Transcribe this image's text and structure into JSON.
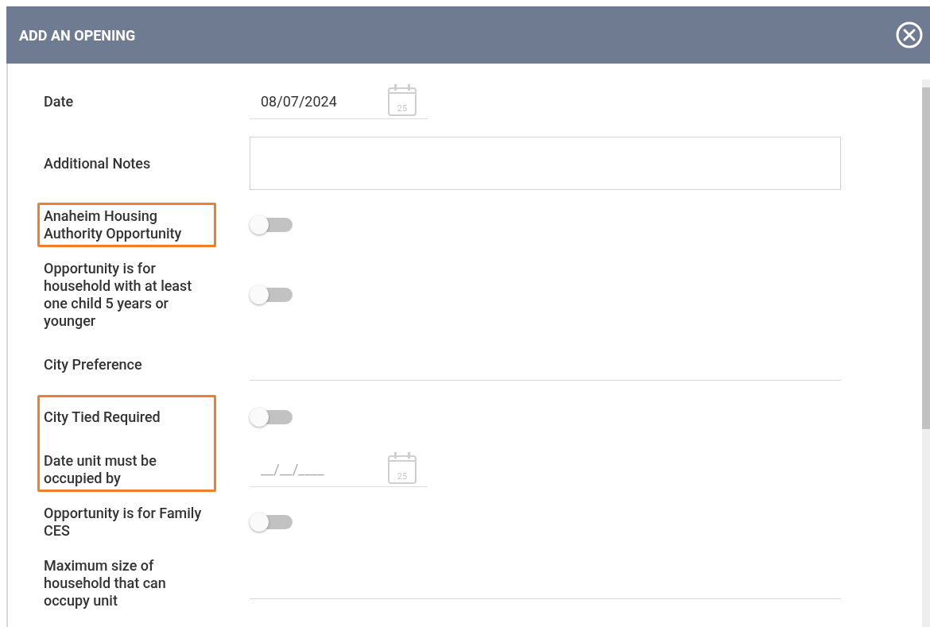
{
  "dialog": {
    "title": "ADD AN OPENING"
  },
  "groups": [
    {
      "highlighted": false,
      "fields": [
        {
          "kind": "date",
          "label": "Date",
          "value": "08/07/2024",
          "calendar_day": "25"
        },
        {
          "kind": "textarea",
          "label": "Additional Notes"
        }
      ]
    },
    {
      "highlighted": true,
      "fields": [
        {
          "kind": "toggle",
          "label": "Anaheim Housing Authority Opportunity",
          "on": false
        }
      ]
    },
    {
      "highlighted": false,
      "fields": [
        {
          "kind": "toggle",
          "label": "Opportunity is for household with at least one child 5 years or younger",
          "on": false
        },
        {
          "kind": "text",
          "label": "City Preference"
        }
      ]
    },
    {
      "highlighted": true,
      "fields": [
        {
          "kind": "toggle",
          "label": "City Tied Required",
          "on": false
        },
        {
          "kind": "date",
          "label": "Date unit must be occupied by",
          "placeholder": "__/__/____",
          "calendar_day": "25"
        }
      ]
    },
    {
      "highlighted": false,
      "fields": [
        {
          "kind": "toggle",
          "label": "Opportunity is for Family CES",
          "on": false
        },
        {
          "kind": "text",
          "label": "Maximum size of household that can occupy unit"
        }
      ]
    }
  ]
}
